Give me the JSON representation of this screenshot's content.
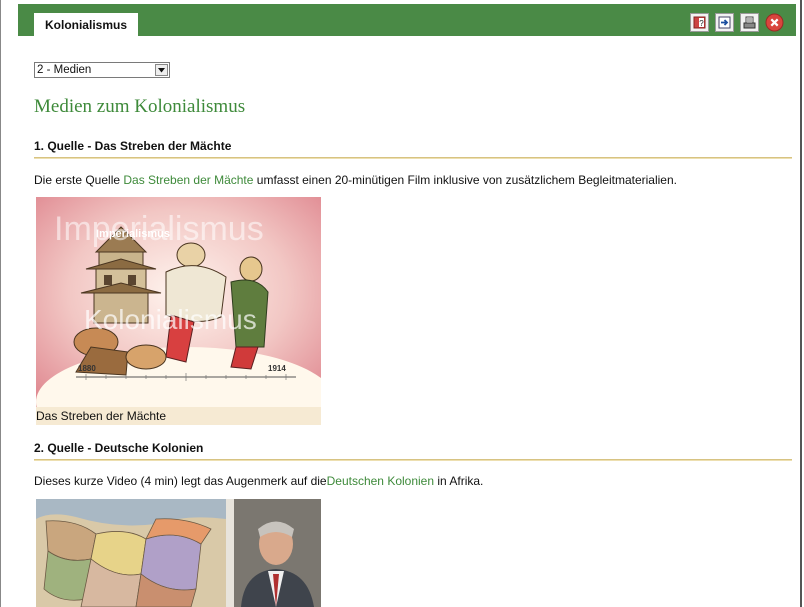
{
  "window": {
    "tab_label": "Kolonialismus",
    "toolbar_icons": [
      "help-book-icon",
      "export-icon",
      "print-icon",
      "close-icon"
    ],
    "accent_color": "#4a8a46",
    "link_color": "#3e8a3a"
  },
  "navigation": {
    "select_value": "2 - Medien"
  },
  "main": {
    "title": "Medien zum Kolonialismus",
    "sections": [
      {
        "heading": "1. Quelle - Das Streben der Mächte",
        "text_before": "Die erste Quelle ",
        "link_text": "Das Streben der Mächte",
        "text_after": " umfasst einen 20-minütigen Film inklusive von zusätzlichem Begleitmaterialien.",
        "image": {
          "title_text_top": "Imperialismus",
          "title_text_small": "Imperialismus",
          "title_text_bottom": "Kolonialismus",
          "timeline_start": "1880",
          "timeline_end": "1914"
        },
        "caption": "Das Streben der Mächte"
      },
      {
        "heading": "2. Quelle - Deutsche Kolonien",
        "text_before": "Dieses kurze Video (4 min) legt das Augenmerk auf die",
        "link_text": "Deutschen Kolonien",
        "text_after": " in Afrika."
      }
    ]
  }
}
